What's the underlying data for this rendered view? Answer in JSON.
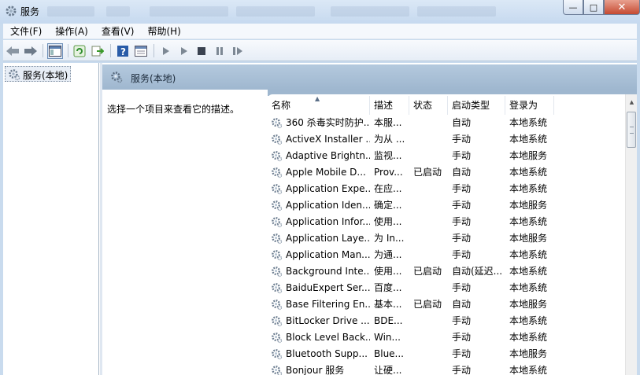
{
  "window": {
    "title": "服务",
    "controls": {
      "minimize": "—",
      "maximize": "□",
      "close": "✕"
    }
  },
  "menu": [
    "文件(F)",
    "操作(A)",
    "查看(V)",
    "帮助(H)"
  ],
  "toolbar": {
    "icons": [
      "back-icon",
      "forward-icon",
      "show-hide-tree-icon",
      "refresh-icon",
      "export-list-icon",
      "help-icon",
      "properties-icon",
      "start-service-icon",
      "start-service-params-icon",
      "stop-service-icon",
      "pause-service-icon",
      "restart-service-icon"
    ]
  },
  "tree": {
    "root_label": "服务(本地)"
  },
  "pane": {
    "title": "服务(本地)",
    "description_hint": "选择一个项目来查看它的描述。"
  },
  "columns": {
    "name": "名称",
    "description": "描述",
    "status": "状态",
    "startup": "启动类型",
    "logon": "登录为"
  },
  "services": [
    {
      "name": "360 杀毒实时防护...",
      "description": "本服...",
      "status": "",
      "startup": "自动",
      "logon": "本地系统"
    },
    {
      "name": "ActiveX Installer ...",
      "description": "为从 ...",
      "status": "",
      "startup": "手动",
      "logon": "本地系统"
    },
    {
      "name": "Adaptive Brightn...",
      "description": "监视...",
      "status": "",
      "startup": "手动",
      "logon": "本地服务"
    },
    {
      "name": "Apple Mobile D...",
      "description": "Prov...",
      "status": "已启动",
      "startup": "自动",
      "logon": "本地系统"
    },
    {
      "name": "Application Expe...",
      "description": "在应...",
      "status": "",
      "startup": "手动",
      "logon": "本地系统"
    },
    {
      "name": "Application Iden...",
      "description": "确定...",
      "status": "",
      "startup": "手动",
      "logon": "本地服务"
    },
    {
      "name": "Application Infor...",
      "description": "使用...",
      "status": "",
      "startup": "手动",
      "logon": "本地系统"
    },
    {
      "name": "Application Laye...",
      "description": "为 In...",
      "status": "",
      "startup": "手动",
      "logon": "本地服务"
    },
    {
      "name": "Application Man...",
      "description": "为通...",
      "status": "",
      "startup": "手动",
      "logon": "本地系统"
    },
    {
      "name": "Background Inte...",
      "description": "使用...",
      "status": "已启动",
      "startup": "自动(延迟...",
      "logon": "本地系统"
    },
    {
      "name": "BaiduExpert Ser...",
      "description": "百度...",
      "status": "",
      "startup": "手动",
      "logon": "本地系统"
    },
    {
      "name": "Base Filtering En...",
      "description": "基本...",
      "status": "已启动",
      "startup": "自动",
      "logon": "本地服务"
    },
    {
      "name": "BitLocker Drive ...",
      "description": "BDE...",
      "status": "",
      "startup": "手动",
      "logon": "本地系统"
    },
    {
      "name": "Block Level Back...",
      "description": "Win...",
      "status": "",
      "startup": "手动",
      "logon": "本地系统"
    },
    {
      "name": "Bluetooth Supp...",
      "description": "Blue...",
      "status": "",
      "startup": "手动",
      "logon": "本地服务"
    },
    {
      "name": "Bonjour 服务",
      "description": "让硬...",
      "status": "",
      "startup": "手动",
      "logon": "本地系统"
    }
  ],
  "colors": {
    "titlebar": "#c6d9ef",
    "header": "#9fb7cf",
    "frame": "#c9dbee"
  }
}
